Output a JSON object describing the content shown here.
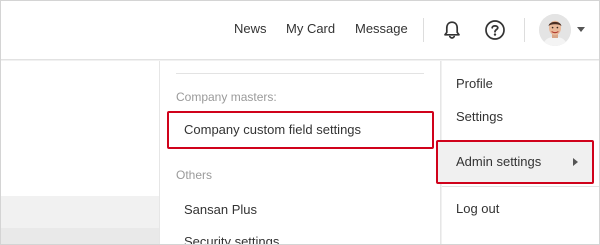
{
  "header": {
    "nav": [
      "News",
      "My Card",
      "Message"
    ],
    "icons": {
      "notifications": "bell-icon",
      "help": "help-circle-icon",
      "account_menu": "chevron-down-icon"
    }
  },
  "admin_panel": {
    "sections": [
      {
        "heading": "Company masters:",
        "items": [
          "Company custom field settings"
        ]
      },
      {
        "heading": "Others",
        "items": [
          "Sansan Plus",
          "Security settings"
        ]
      }
    ]
  },
  "user_menu": {
    "items": [
      "Profile",
      "Settings",
      "Admin settings",
      "Log out"
    ],
    "active": "Admin settings"
  },
  "colors": {
    "highlight": "#d0021b",
    "active_bg": "#f0f0f0",
    "muted_text": "#9a9a9a"
  }
}
